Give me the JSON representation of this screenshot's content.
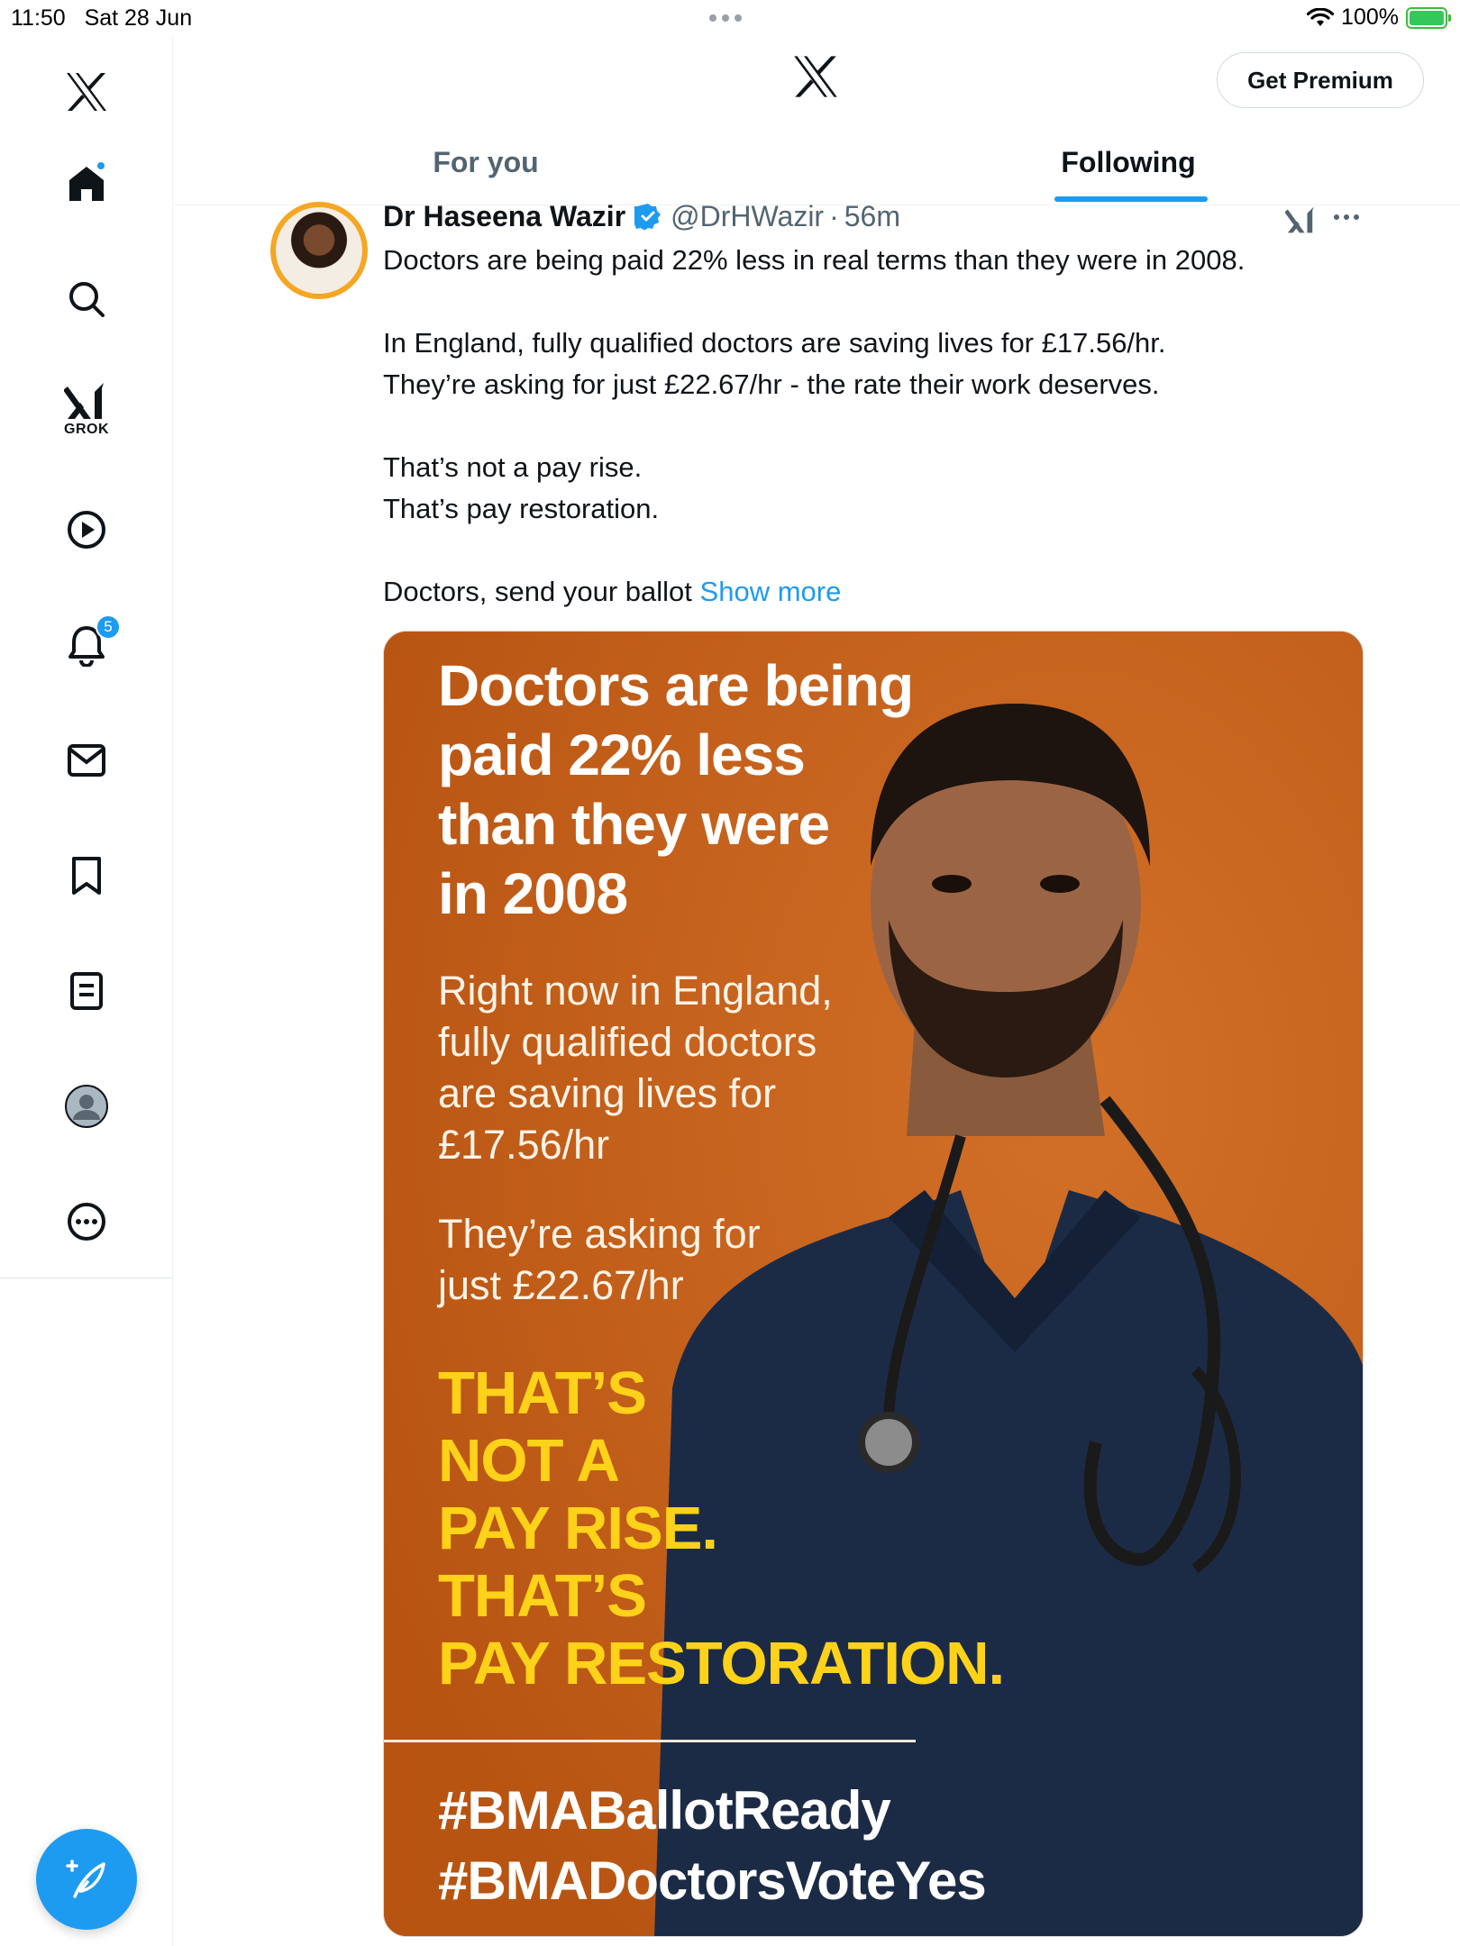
{
  "status_bar": {
    "time": "11:50",
    "date": "Sat 28 Jun",
    "battery": "100%"
  },
  "sidebar": {
    "grok_label": "GROK",
    "notification_count": "5",
    "items": [
      "x-logo",
      "home",
      "search",
      "grok",
      "video",
      "notifications",
      "messages",
      "bookmarks",
      "lists",
      "profile",
      "more"
    ]
  },
  "header": {
    "premium_button": "Get Premium",
    "tabs": [
      {
        "label": "For you",
        "active": false
      },
      {
        "label": "Following",
        "active": true
      }
    ]
  },
  "tweet": {
    "author_name": "Dr Haseena Wazir",
    "handle": "@DrHWazir",
    "separator": "·",
    "time": "56m",
    "lines": {
      "l1": "Doctors are being paid 22% less in real terms than they were in 2008.",
      "l2": "In England, fully qualified doctors are saving lives for £17.56/hr.",
      "l3": "They’re asking for just £22.67/hr - the rate their work deserves.",
      "l4": "That’s not a pay rise.",
      "l5": "That’s pay restoration.",
      "l6": "Doctors, send your ballot"
    },
    "show_more": "Show more"
  },
  "media": {
    "headline": [
      "Doctors are being",
      "paid 22% less",
      "than they were",
      "in 2008"
    ],
    "sub1": [
      "Right now in England,",
      "fully qualified doctors",
      "are saving lives for",
      "£17.56/hr"
    ],
    "sub2": [
      "They’re asking for",
      "just £22.67/hr"
    ],
    "yellow": [
      "THAT’S",
      "NOT A",
      "PAY RISE.",
      "THAT’S",
      "PAY RESTORATION."
    ],
    "hashtags": [
      "#BMABallotReady",
      "#BMADoctorsVoteYes"
    ],
    "colors": {
      "background": "#c9641a",
      "accent_yellow": "#ffd21a",
      "scrubs": "#1c2b45"
    }
  },
  "colors": {
    "accent": "#1d9bf0",
    "text": "#0f1419",
    "secondary": "#536471"
  }
}
